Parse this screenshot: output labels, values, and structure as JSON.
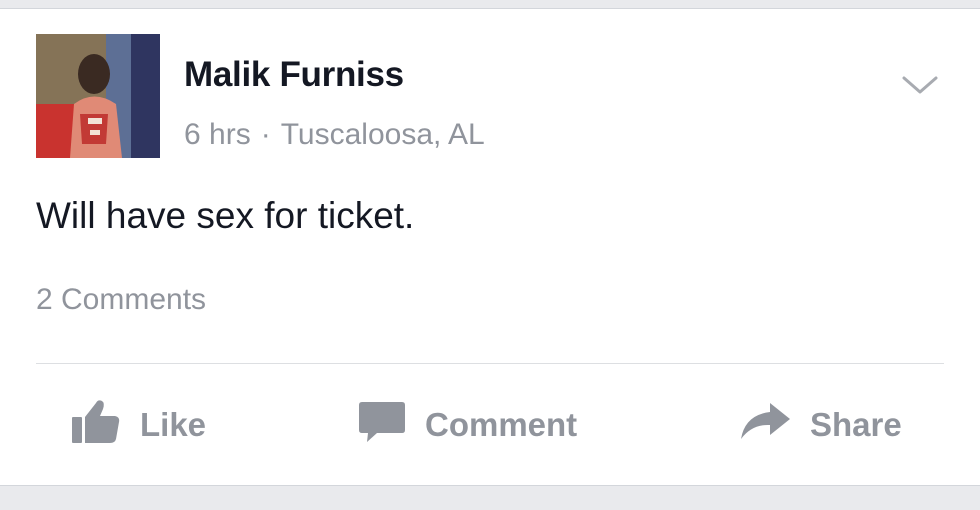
{
  "post": {
    "author": "Malik Furniss",
    "time": "6 hrs",
    "separator": "·",
    "location": "Tuscaloosa, AL",
    "text": "Will have sex for ticket.",
    "comments_count": "2 Comments"
  },
  "actions": {
    "like_label": "Like",
    "comment_label": "Comment",
    "share_label": "Share"
  },
  "icons": {
    "menu": "chevron-down-icon",
    "like": "thumbs-up-icon",
    "comment": "speech-bubble-icon",
    "share": "share-arrow-icon"
  },
  "colors": {
    "name": "#141823",
    "meta": "#90949c",
    "action": "#90949c",
    "background": "#e9eaed",
    "card": "#ffffff"
  }
}
